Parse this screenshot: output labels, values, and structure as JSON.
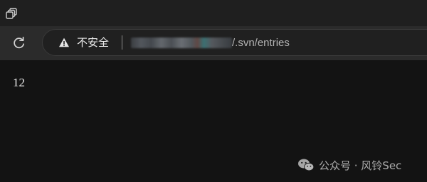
{
  "browser": {
    "tab_icon": "tab-actions-icon",
    "reload_icon": "reload-icon",
    "address_bar": {
      "security_icon": "warning-triangle-icon",
      "security_label": "不安全",
      "host": "",
      "path": "/.svn/entries"
    }
  },
  "page": {
    "content_text": "12"
  },
  "watermark": {
    "icon": "wechat-icon",
    "text": "公众号 · 风铃Sec"
  },
  "colors": {
    "page_background": "#131313",
    "toolbar_background": "#2b2b2b",
    "omnibox_background": "#202020",
    "text": "#e8e8e8"
  }
}
